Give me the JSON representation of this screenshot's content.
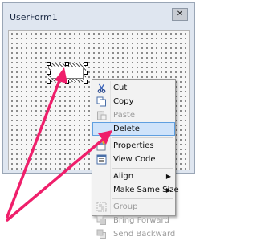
{
  "window": {
    "title": "UserForm1",
    "close_glyph": "✕"
  },
  "menu": {
    "items": [
      {
        "label": "Cut",
        "icon": "scissors-icon",
        "enabled": true
      },
      {
        "label": "Copy",
        "icon": "copy-icon",
        "enabled": true
      },
      {
        "label": "Paste",
        "icon": "paste-icon",
        "enabled": false
      },
      {
        "label": "Delete",
        "icon": "",
        "enabled": true,
        "highlighted": true
      },
      {
        "label": "Properties",
        "icon": "properties-icon",
        "enabled": true
      },
      {
        "label": "View Code",
        "icon": "view-code-icon",
        "enabled": true
      },
      {
        "label": "Align",
        "icon": "",
        "enabled": true,
        "submenu": true
      },
      {
        "label": "Make Same Size",
        "icon": "",
        "enabled": true,
        "submenu": true
      },
      {
        "label": "Group",
        "icon": "group-icon",
        "enabled": false
      },
      {
        "label": "Bring Forward",
        "icon": "bring-forward-icon",
        "enabled": false
      },
      {
        "label": "Send Backward",
        "icon": "send-backward-icon",
        "enabled": false
      }
    ],
    "submenu_glyph": "▶"
  },
  "colors": {
    "arrow": "#ef1f6b",
    "highlight": "#cfe3fa"
  }
}
